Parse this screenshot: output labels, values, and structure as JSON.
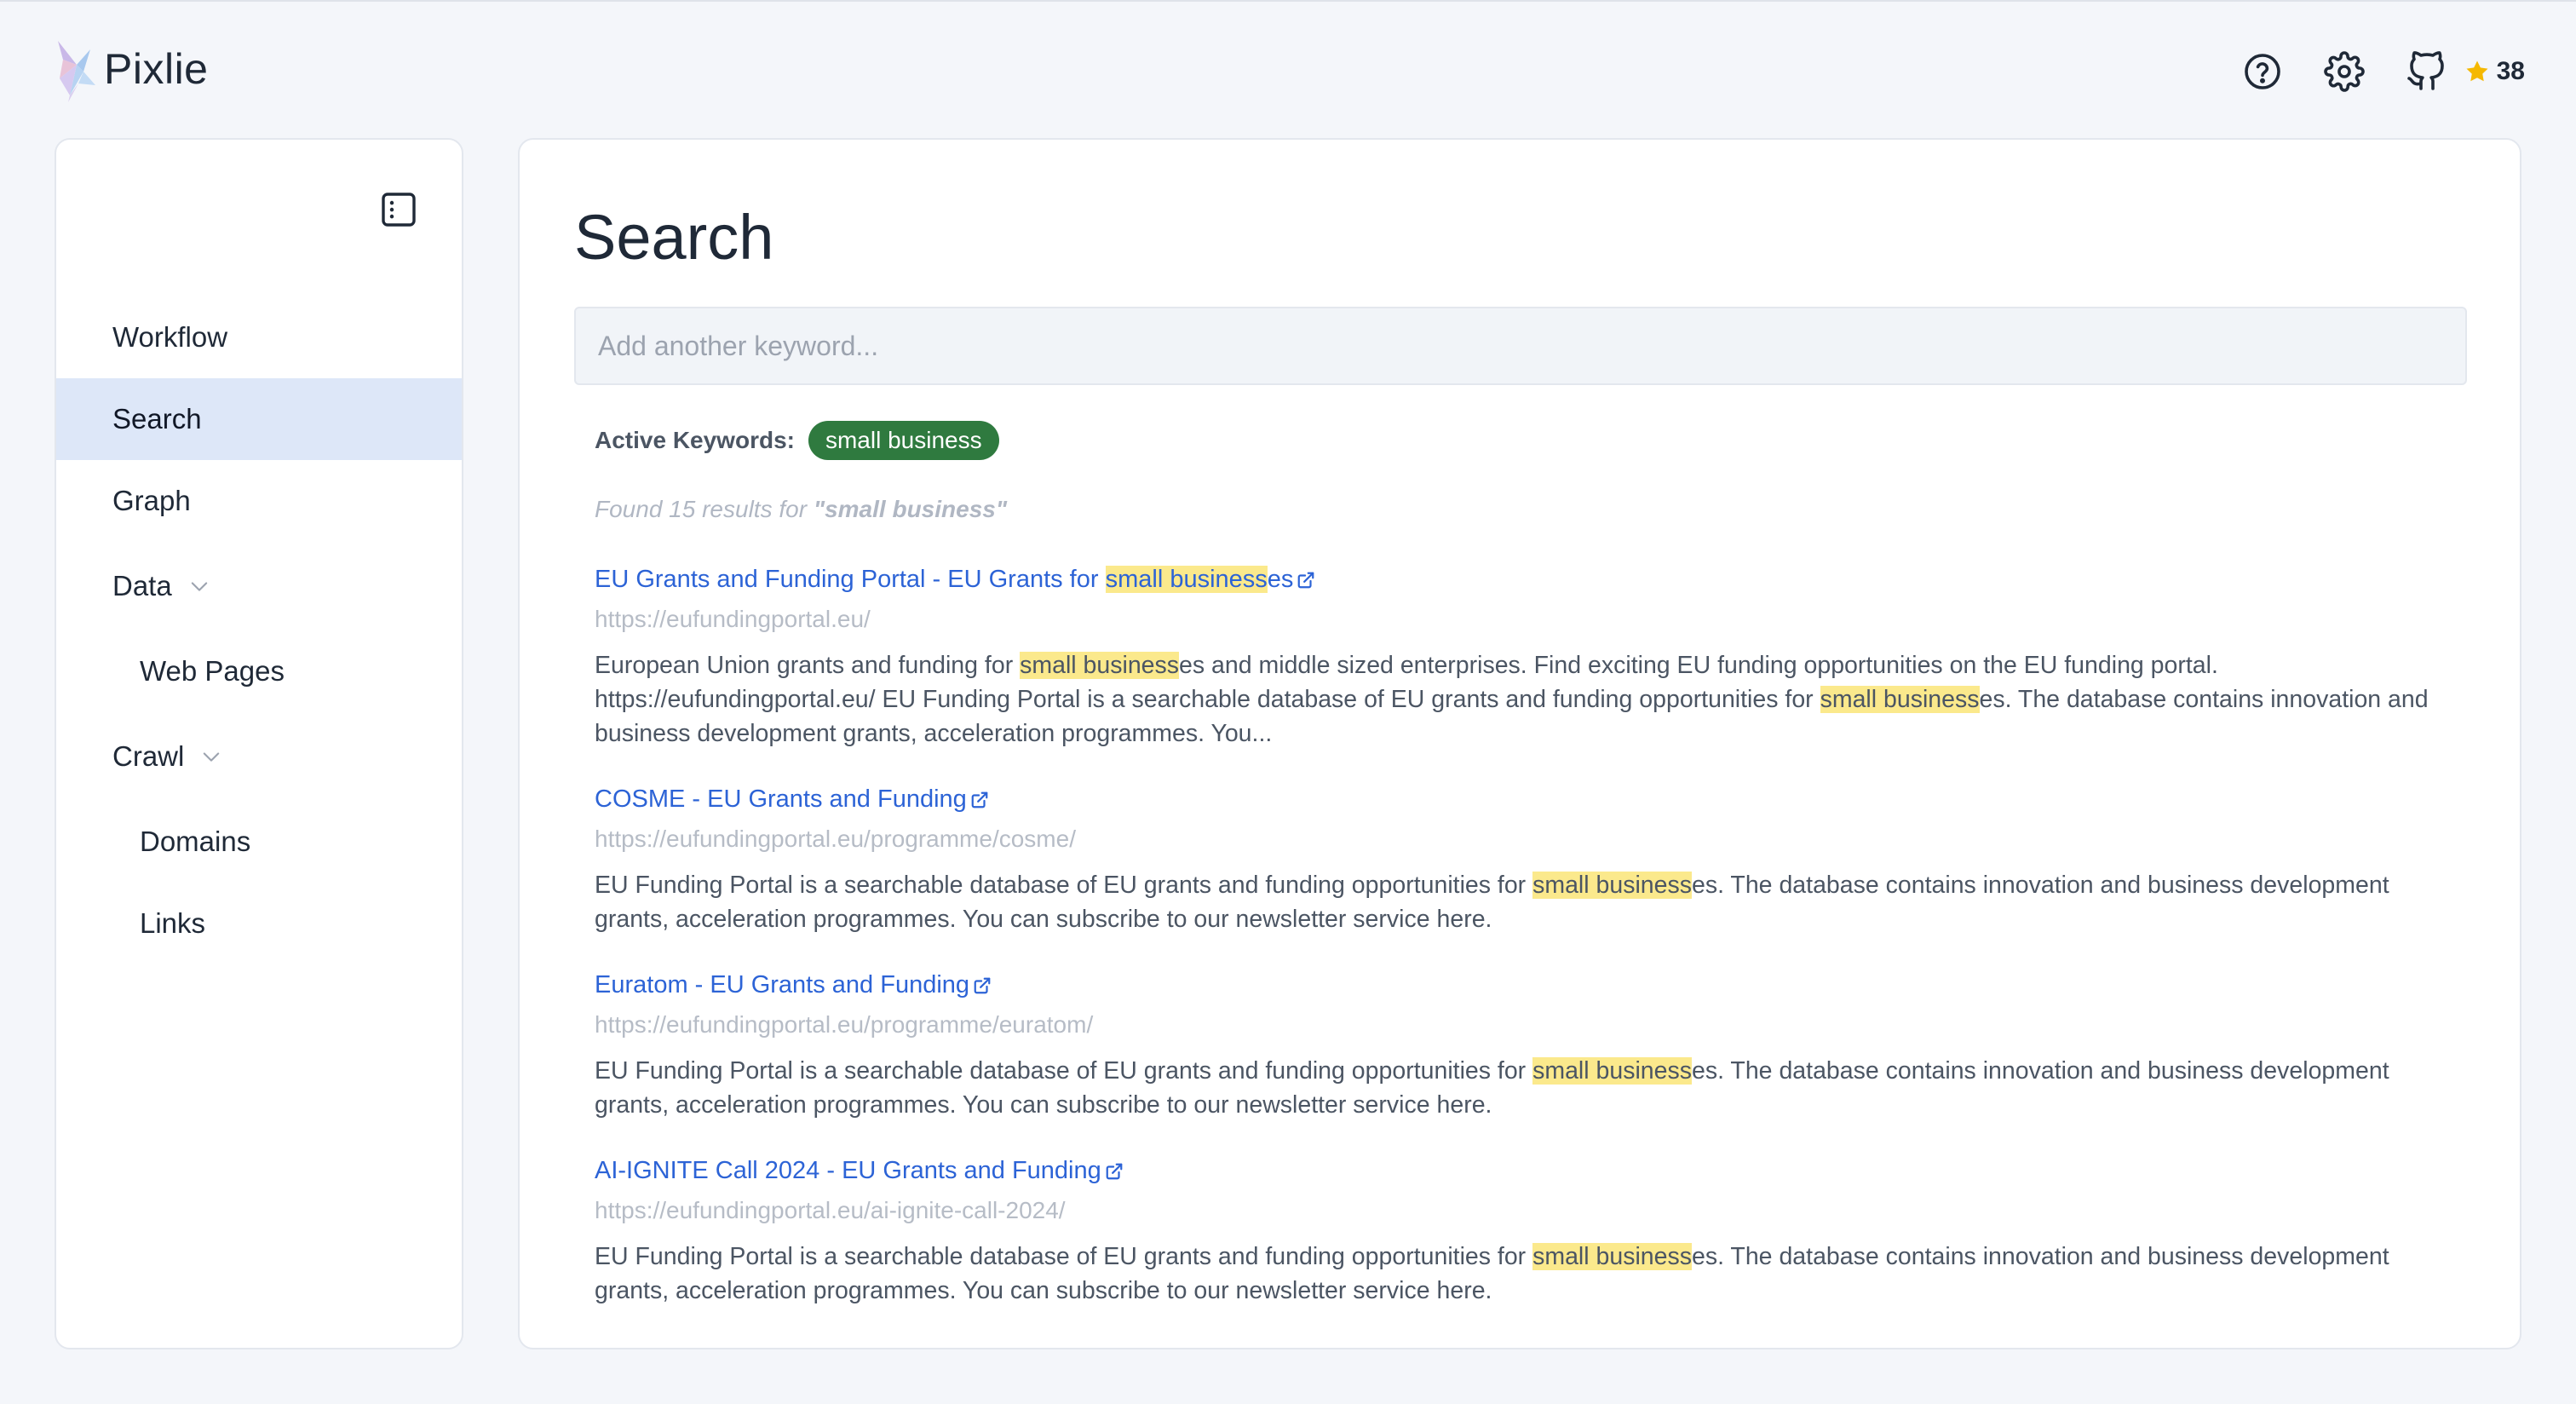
{
  "app": {
    "name": "Pixlie"
  },
  "header": {
    "icons": [
      "help-icon",
      "gear-icon",
      "github-icon"
    ],
    "star_count": "38",
    "star_color": "#f5b800"
  },
  "sidebar": {
    "items": [
      {
        "label": "Workflow"
      },
      {
        "label": "Search",
        "active": true
      },
      {
        "label": "Graph"
      },
      {
        "label": "Data",
        "expandable": true
      },
      {
        "label": "Web Pages"
      },
      {
        "label": "Crawl",
        "expandable": true
      },
      {
        "label": "Domains"
      },
      {
        "label": "Links"
      }
    ],
    "active_color": "#dde7f8"
  },
  "main": {
    "title": "Search",
    "search": {
      "placeholder": "Add another keyword...",
      "value": ""
    },
    "keywords_label": "Active Keywords:",
    "keywords": [
      "small business"
    ],
    "found_prefix": "Found 15 results for",
    "found_query": "\"small business\"",
    "results": [
      {
        "title_pre": "EU Grants and Funding Portal - EU Grants for ",
        "title_hl": "small business",
        "title_post": "es",
        "url": "https://eufundingportal.eu/",
        "s1": "European Union grants and funding for ",
        "h1": "small business",
        "s2": "es and middle sized enterprises. Find exciting EU funding opportunities on the EU funding portal. https://eufundingportal.eu/ EU Funding Portal is a searchable database of EU grants and funding opportunities for ",
        "h2": "small business",
        "s3": "es. The database contains innovation and business development grants, acceleration programmes. You..."
      },
      {
        "title": "COSME - EU Grants and Funding",
        "url": "https://eufundingportal.eu/programme/cosme/",
        "s1": "EU Funding Portal is a searchable database of EU grants and funding opportunities for ",
        "h1": "small business",
        "s2": "es. The database contains innovation and business development grants, acceleration programmes. You can subscribe to our newsletter service here."
      },
      {
        "title": "Euratom - EU Grants and Funding",
        "url": "https://eufundingportal.eu/programme/euratom/",
        "s1": "EU Funding Portal is a searchable database of EU grants and funding opportunities for ",
        "h1": "small business",
        "s2": "es. The database contains innovation and business development grants, acceleration programmes. You can subscribe to our newsletter service here."
      },
      {
        "title": "AI-IGNITE Call 2024 - EU Grants and Funding",
        "url": "https://eufundingportal.eu/ai-ignite-call-2024/",
        "s1": "EU Funding Portal is a searchable database of EU grants and funding opportunities for ",
        "h1": "small business",
        "s2": "es. The database contains innovation and business development grants, acceleration programmes. You can subscribe to our newsletter service here."
      }
    ],
    "link_color": "#2c63d6",
    "highlight_color": "#fbe98c",
    "chip_color": "#2f7a3f"
  }
}
